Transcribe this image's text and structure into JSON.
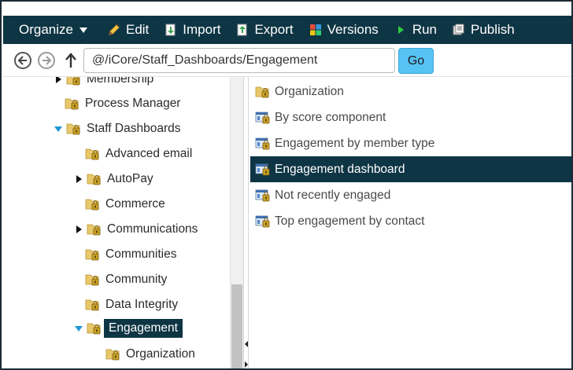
{
  "toolbar": {
    "organize": "Organize",
    "edit": "Edit",
    "import": "Import",
    "export": "Export",
    "versions": "Versions",
    "run": "Run",
    "publish": "Publish"
  },
  "address": {
    "path": "@/iCore/Staff_Dashboards/Engagement",
    "go": "Go"
  },
  "tree": [
    {
      "label": "Membership",
      "expander": "collapsed"
    },
    {
      "label": "Process Manager",
      "expander": "none"
    },
    {
      "label": "Staff Dashboards",
      "expander": "expanded"
    },
    {
      "label": "Advanced email",
      "expander": "none"
    },
    {
      "label": "AutoPay",
      "expander": "collapsed"
    },
    {
      "label": "Commerce",
      "expander": "none"
    },
    {
      "label": "Communications",
      "expander": "collapsed"
    },
    {
      "label": "Communities",
      "expander": "none"
    },
    {
      "label": "Community",
      "expander": "none"
    },
    {
      "label": "Data Integrity",
      "expander": "none"
    },
    {
      "label": "Engagement",
      "expander": "expanded",
      "selected": true
    },
    {
      "label": "Organization",
      "expander": "none"
    }
  ],
  "list": [
    {
      "label": "Organization",
      "icon": "folder-lock-icon"
    },
    {
      "label": "By score component",
      "icon": "dashboard-lock-icon"
    },
    {
      "label": "Engagement by member type",
      "icon": "dashboard-lock-icon"
    },
    {
      "label": "Engagement dashboard",
      "icon": "dashboard-lock-icon",
      "selected": true
    },
    {
      "label": "Not recently engaged",
      "icon": "dashboard-lock-icon"
    },
    {
      "label": "Top engagement by contact",
      "icon": "dashboard-lock-icon"
    }
  ],
  "colors": {
    "toolbar_bg": "#0e3544",
    "selection_bg": "#0e3544",
    "go_button": "#56c3f5",
    "expand_arrow": "#2196d3"
  }
}
